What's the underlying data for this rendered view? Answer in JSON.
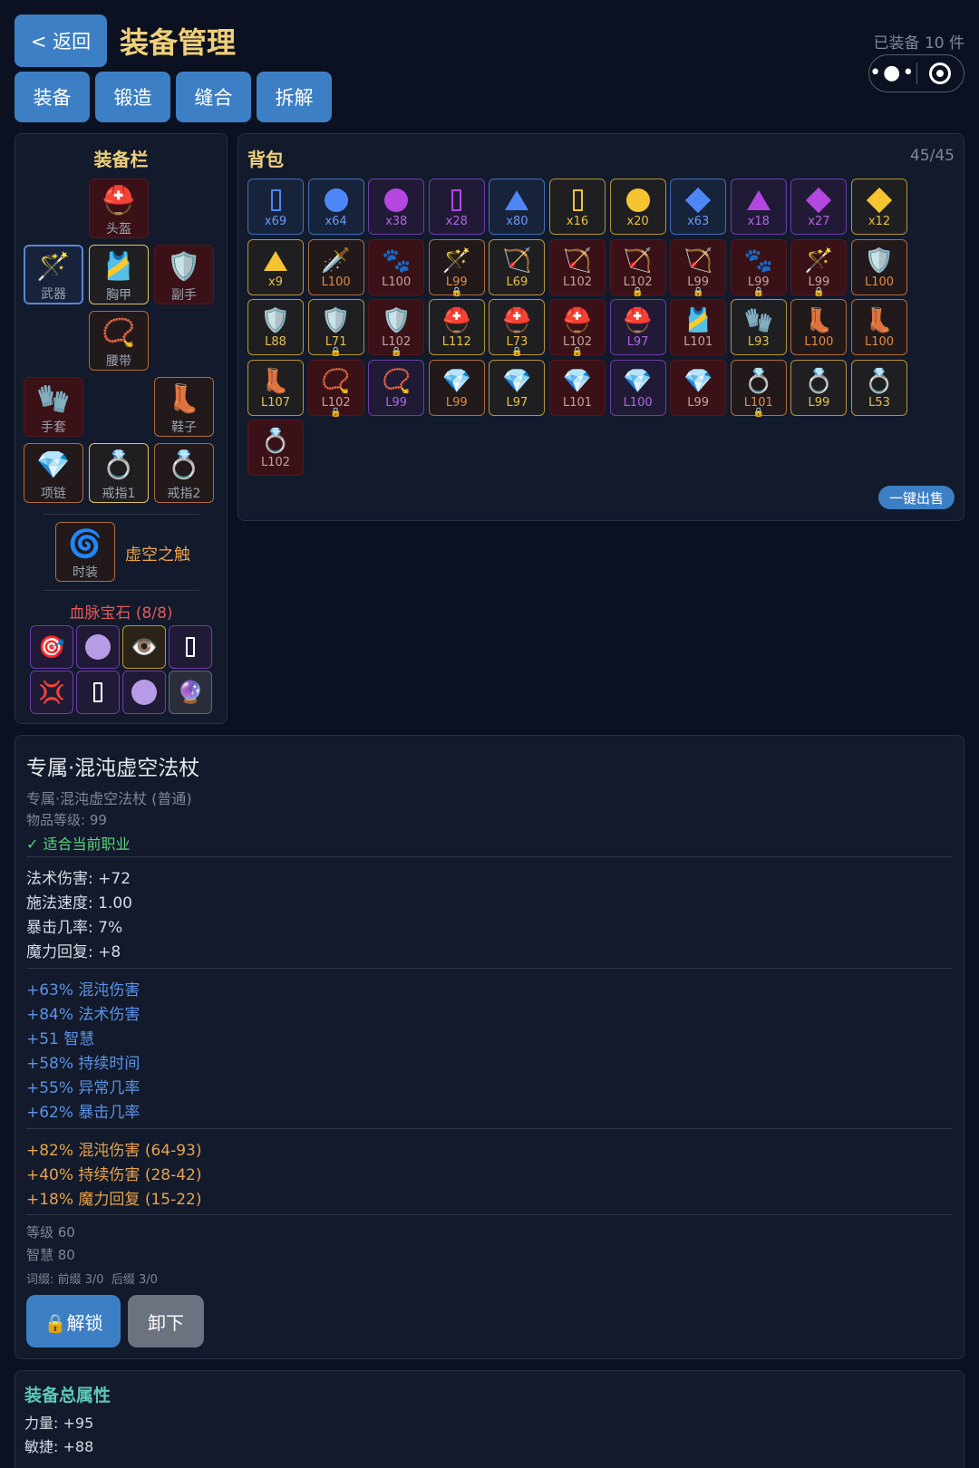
{
  "header": {
    "back_label": "< 返回",
    "title": "装备管理",
    "equipped_count": "已装备 10 件",
    "tabs": [
      "装备",
      "锻造",
      "缝合",
      "拆解"
    ]
  },
  "equip": {
    "title": "装备栏",
    "slots": {
      "helmet": {
        "label": "头盔",
        "icon": "⛑️"
      },
      "weapon": {
        "label": "武器",
        "icon": "🪄"
      },
      "chest": {
        "label": "胸甲",
        "icon": "🎽"
      },
      "offhand": {
        "label": "副手",
        "icon": "🛡️"
      },
      "belt": {
        "label": "腰带",
        "icon": "📿"
      },
      "gloves": {
        "label": "手套",
        "icon": "🧤"
      },
      "boots": {
        "label": "鞋子",
        "icon": "👢"
      },
      "necklace": {
        "label": "项链",
        "icon": "💎"
      },
      "ring1": {
        "label": "戒指1",
        "icon": "💍"
      },
      "ring2": {
        "label": "戒指2",
        "icon": "💍"
      }
    },
    "fashion": {
      "label": "时装",
      "icon": "🌀",
      "name": "虚空之触"
    },
    "gems_title": "血脉宝石 (8/8)",
    "gems": [
      {
        "icon": "🎯"
      },
      {
        "icon": "circle"
      },
      {
        "icon": "👁️"
      },
      {
        "icon": "rect"
      },
      {
        "icon": "💢"
      },
      {
        "icon": "rect"
      },
      {
        "icon": "circle"
      },
      {
        "icon": "🔮"
      }
    ]
  },
  "bag": {
    "title": "背包",
    "count": "45/45",
    "sell_label": "一键出售",
    "items": [
      {
        "shape": "rect",
        "color": "#4f86f7",
        "q": "blue",
        "label": "x69",
        "lc": "#6a9cf5"
      },
      {
        "shape": "circle",
        "color": "#4f86f7",
        "q": "blue",
        "label": "x64",
        "lc": "#6a9cf5"
      },
      {
        "shape": "circle",
        "color": "#b347e0",
        "q": "purple",
        "label": "x38",
        "lc": "#b066e0"
      },
      {
        "shape": "rect",
        "color": "#b347e0",
        "q": "purple",
        "label": "x28",
        "lc": "#b066e0"
      },
      {
        "shape": "tri",
        "color": "#4f86f7",
        "q": "blue",
        "label": "x80",
        "lc": "#6a9cf5"
      },
      {
        "shape": "rect",
        "color": "#f5c431",
        "q": "yellow",
        "label": "x16",
        "lc": "#e8c04a"
      },
      {
        "shape": "circle",
        "color": "#f5c431",
        "q": "yellow",
        "label": "x20",
        "lc": "#e8c04a"
      },
      {
        "shape": "dia",
        "color": "#4f86f7",
        "q": "blue",
        "label": "x63",
        "lc": "#6a9cf5"
      },
      {
        "shape": "tri",
        "color": "#b347e0",
        "q": "purple",
        "label": "x18",
        "lc": "#b066e0"
      },
      {
        "shape": "dia",
        "color": "#b347e0",
        "q": "purple",
        "label": "x27",
        "lc": "#b066e0"
      },
      {
        "shape": "dia",
        "color": "#f5c431",
        "q": "yellow",
        "label": "x12",
        "lc": "#e8c04a"
      },
      {
        "shape": "tri",
        "color": "#f5c431",
        "q": "yellow",
        "label": "x9",
        "lc": "#e8c04a"
      },
      {
        "icon": "🗡️",
        "q": "orange",
        "label": "L100",
        "lc": "#e08a4a"
      },
      {
        "icon": "🐾",
        "q": "red",
        "label": "L100",
        "lc": "#c8a0a0"
      },
      {
        "icon": "🪄",
        "q": "orange",
        "label": "L99",
        "lc": "#e08a4a",
        "lock": true
      },
      {
        "icon": "🏹",
        "q": "yellow",
        "label": "L69",
        "lc": "#e8c04a"
      },
      {
        "icon": "🏹",
        "q": "red",
        "label": "L102",
        "lc": "#c8a0a0"
      },
      {
        "icon": "🏹",
        "q": "red",
        "label": "L102",
        "lc": "#c8a0a0",
        "lock": true
      },
      {
        "icon": "🏹",
        "q": "red",
        "label": "L99",
        "lc": "#c8a0a0",
        "lock": true
      },
      {
        "icon": "🐾",
        "q": "red",
        "label": "L99",
        "lc": "#c8a0a0",
        "lock": true
      },
      {
        "icon": "🪄",
        "q": "red",
        "label": "L99",
        "lc": "#c8a0a0",
        "lock": true
      },
      {
        "icon": "🛡️",
        "q": "orange",
        "label": "L100",
        "lc": "#e08a4a"
      },
      {
        "icon": "🛡️",
        "q": "yellow",
        "label": "L88",
        "lc": "#e8c04a"
      },
      {
        "icon": "🛡️",
        "q": "yellow",
        "label": "L71",
        "lc": "#e8c04a",
        "lock": true
      },
      {
        "icon": "🛡️",
        "q": "red",
        "label": "L102",
        "lc": "#c8a0a0",
        "lock": true
      },
      {
        "icon": "⛑️",
        "q": "yellow",
        "label": "L112",
        "lc": "#e8c04a"
      },
      {
        "icon": "⛑️",
        "q": "yellow",
        "label": "L73",
        "lc": "#e8c04a",
        "lock": true
      },
      {
        "icon": "⛑️",
        "q": "red",
        "label": "L102",
        "lc": "#c8a0a0",
        "lock": true
      },
      {
        "icon": "⛑️",
        "q": "purple",
        "label": "L97",
        "lc": "#b066e0"
      },
      {
        "icon": "🎽",
        "q": "red",
        "label": "L101",
        "lc": "#c8a0a0"
      },
      {
        "icon": "🧤",
        "q": "yellow",
        "label": "L93",
        "lc": "#e8c04a"
      },
      {
        "icon": "👢",
        "q": "orange",
        "label": "L100",
        "lc": "#e08a4a"
      },
      {
        "icon": "👢",
        "q": "orange",
        "label": "L100",
        "lc": "#e08a4a"
      },
      {
        "icon": "👢",
        "q": "yellow",
        "label": "L107",
        "lc": "#e8c04a"
      },
      {
        "icon": "📿",
        "q": "red",
        "label": "L102",
        "lc": "#c8a0a0",
        "lock": true
      },
      {
        "icon": "📿",
        "q": "purple",
        "label": "L99",
        "lc": "#b066e0"
      },
      {
        "icon": "💎",
        "q": "orange",
        "label": "L99",
        "lc": "#e08a4a"
      },
      {
        "icon": "💎",
        "q": "yellow",
        "label": "L97",
        "lc": "#e8c04a"
      },
      {
        "icon": "💎",
        "q": "red",
        "label": "L101",
        "lc": "#c8a0a0"
      },
      {
        "icon": "💎",
        "q": "purple",
        "label": "L100",
        "lc": "#b066e0"
      },
      {
        "icon": "💎",
        "q": "red",
        "label": "L99",
        "lc": "#c8a0a0"
      },
      {
        "icon": "💍",
        "q": "orange",
        "label": "L101",
        "lc": "#e08a4a",
        "lock": true
      },
      {
        "icon": "💍",
        "q": "yellow",
        "label": "L99",
        "lc": "#e8c04a"
      },
      {
        "icon": "💍",
        "q": "yellow",
        "label": "L53",
        "lc": "#e8c04a"
      },
      {
        "icon": "💍",
        "q": "red",
        "label": "L102",
        "lc": "#c8a0a0"
      }
    ]
  },
  "detail": {
    "name": "专属·混沌虚空法杖",
    "subtitle": "专属·混沌虚空法杖 (普通)",
    "item_level": "物品等级: 99",
    "class_ok": "✓ 适合当前职业",
    "base_stats": [
      "法术伤害: +72",
      "施法速度: 1.00",
      "暴击几率: 7%",
      "魔力回复: +8"
    ],
    "affixes": [
      "+63% 混沌伤害",
      "+84% 法术伤害",
      "+51 智慧",
      "+58% 持续时间",
      "+55% 异常几率",
      "+62% 暴击几率"
    ],
    "special": [
      "+82% 混沌伤害 (64-93)",
      "+40% 持续伤害 (28-42)",
      "+18% 魔力回复 (15-22)"
    ],
    "req_level": "等级 60",
    "req_wis": "智慧 80",
    "affix_count": "词缀: 前缀 3/0  后缀 3/0",
    "unlock_label": "🔒解锁",
    "unequip_label": "卸下"
  },
  "totals": {
    "title": "装备总属性",
    "lines": [
      "力量: +95",
      "敏捷: +88"
    ]
  },
  "colors": {
    "gold": "#efd07a",
    "accent": "#3d7fc4",
    "affix_blue": "#5d93e6",
    "special_orange": "#e8a34d",
    "ok_green": "#5bd27a",
    "red_title": "#e05b5b"
  }
}
